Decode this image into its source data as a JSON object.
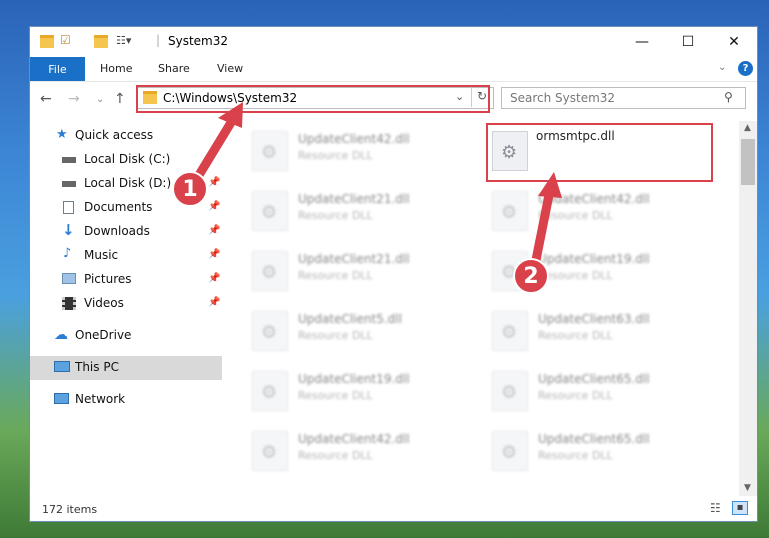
{
  "window": {
    "title": "System32",
    "minimize": "—",
    "maximize": "☐",
    "close": "✕"
  },
  "ribbon": {
    "file": "File",
    "home": "Home",
    "share": "Share",
    "view": "View",
    "help": "?"
  },
  "address": {
    "path": "C:\\Windows\\System32",
    "search_placeholder": "Search System32"
  },
  "sidebar": {
    "quick_access": "Quick access",
    "items": [
      "Local Disk (C:)",
      "Local Disk (D:)",
      "Documents",
      "Downloads",
      "Music",
      "Pictures",
      "Videos"
    ],
    "onedrive": "OneDrive",
    "this_pc": "This PC",
    "network": "Network"
  },
  "files": {
    "left": [
      {
        "name": "UpdateClient42.dll",
        "type": "Resource DLL"
      },
      {
        "name": "UpdateClient21.dll",
        "type": "Resource DLL"
      },
      {
        "name": "UpdateClient21.dll",
        "type": "Resource DLL"
      },
      {
        "name": "UpdateClient5.dll",
        "type": "Resource DLL"
      },
      {
        "name": "UpdateClient19.dll",
        "type": "Resource DLL"
      },
      {
        "name": "UpdateClient42.dll",
        "type": "Resource DLL"
      }
    ],
    "right": [
      {
        "name": "ormsmtpc.dll",
        "type": ""
      },
      {
        "name": "UpdateClient42.dll",
        "type": "Resource DLL"
      },
      {
        "name": "UpdateClient19.dll",
        "type": "Resource DLL"
      },
      {
        "name": "UpdateClient63.dll",
        "type": "Resource DLL"
      },
      {
        "name": "UpdateClient65.dll",
        "type": "Resource DLL"
      },
      {
        "name": "UpdateClient65.dll",
        "type": "Resource DLL"
      }
    ]
  },
  "status": {
    "count": "172 items"
  },
  "annotations": {
    "step1": "1",
    "step2": "2",
    "color": "#d9424a"
  }
}
